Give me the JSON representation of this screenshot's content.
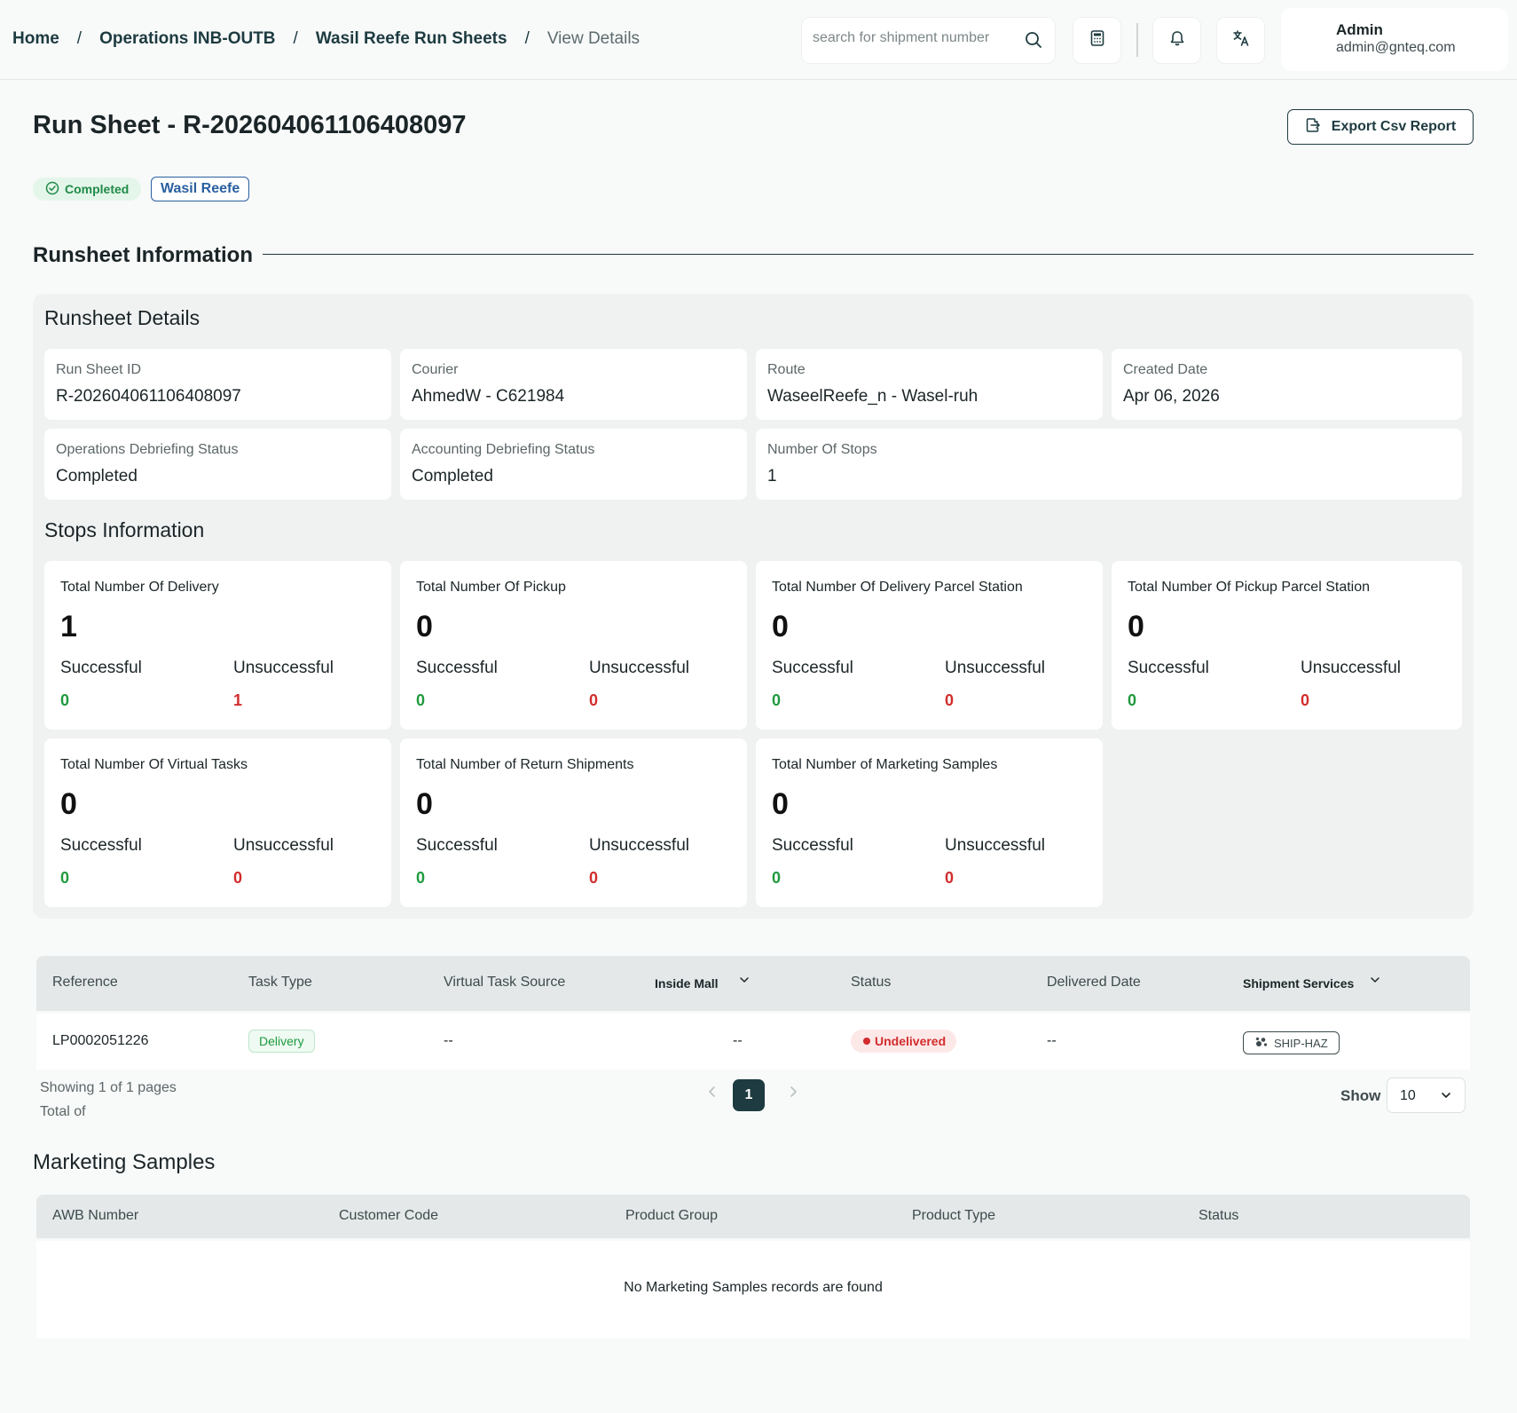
{
  "breadcrumb": {
    "home": "Home",
    "operations": "Operations INB-OUTB",
    "runsheets": "Wasil Reefe Run Sheets",
    "current": "View Details",
    "separator": "/"
  },
  "header": {
    "search_placeholder": "search for shipment number",
    "user_name": "Admin",
    "user_email": "admin@gnteq.com"
  },
  "page": {
    "title": "Run Sheet - R-202604061106408097",
    "export_label": "Export Csv Report",
    "status_badge": "Completed",
    "company_badge": "Wasil Reefe"
  },
  "runsheet_info": {
    "section_title": "Runsheet Information",
    "details_title": "Runsheet Details",
    "fields": [
      {
        "label": "Run Sheet ID",
        "value": "R-202604061106408097"
      },
      {
        "label": "Courier",
        "value": "AhmedW - C621984"
      },
      {
        "label": "Route",
        "value": "WaseelReefe_n - Wasel-ruh"
      },
      {
        "label": "Created Date",
        "value": "Apr 06, 2026"
      },
      {
        "label": "Operations Debriefing Status",
        "value": "Completed"
      },
      {
        "label": "Accounting Debriefing Status",
        "value": "Completed"
      },
      {
        "label": "Number Of Stops",
        "value": "1"
      }
    ]
  },
  "stops": {
    "title": "Stops Information",
    "successful_label": "Successful",
    "unsuccessful_label": "Unsuccessful",
    "cards": [
      {
        "title": "Total Number Of Delivery",
        "total": "1",
        "successful": "0",
        "unsuccessful": "1"
      },
      {
        "title": "Total Number Of Pickup",
        "total": "0",
        "successful": "0",
        "unsuccessful": "0"
      },
      {
        "title": "Total Number Of Delivery Parcel Station",
        "total": "0",
        "successful": "0",
        "unsuccessful": "0"
      },
      {
        "title": "Total Number Of Pickup Parcel Station",
        "total": "0",
        "successful": "0",
        "unsuccessful": "0"
      },
      {
        "title": "Total Number Of Virtual Tasks",
        "total": "0",
        "successful": "0",
        "unsuccessful": "0"
      },
      {
        "title": "Total Number of Return Shipments",
        "total": "0",
        "successful": "0",
        "unsuccessful": "0"
      },
      {
        "title": "Total Number of Marketing Samples",
        "total": "0",
        "successful": "0",
        "unsuccessful": "0"
      }
    ]
  },
  "tasks_table": {
    "columns": [
      "Reference",
      "Task Type",
      "Virtual Task Source",
      "Inside Mall",
      "Status",
      "Delivered Date",
      "Shipment Services"
    ],
    "rows": [
      {
        "reference": "LP0002051226",
        "task_type": "Delivery",
        "virtual_task_source": "--",
        "inside_mall": "--",
        "status": "Undelivered",
        "delivered_date": "--",
        "shipment_services": "SHIP-HAZ"
      }
    ],
    "showing": "Showing 1 of 1 pages",
    "total": "Total of",
    "current_page": "1",
    "show_label": "Show",
    "page_size": "10"
  },
  "marketing_samples": {
    "title": "Marketing Samples",
    "columns": [
      "AWB Number",
      "Customer Code",
      "Product Group",
      "Product Type",
      "Status"
    ],
    "empty": "No Marketing Samples records are found"
  },
  "colors": {
    "primary": "#1d3b40",
    "success": "#1f9a3e",
    "danger": "#d22c2c",
    "link_blue": "#2a5fa0"
  }
}
